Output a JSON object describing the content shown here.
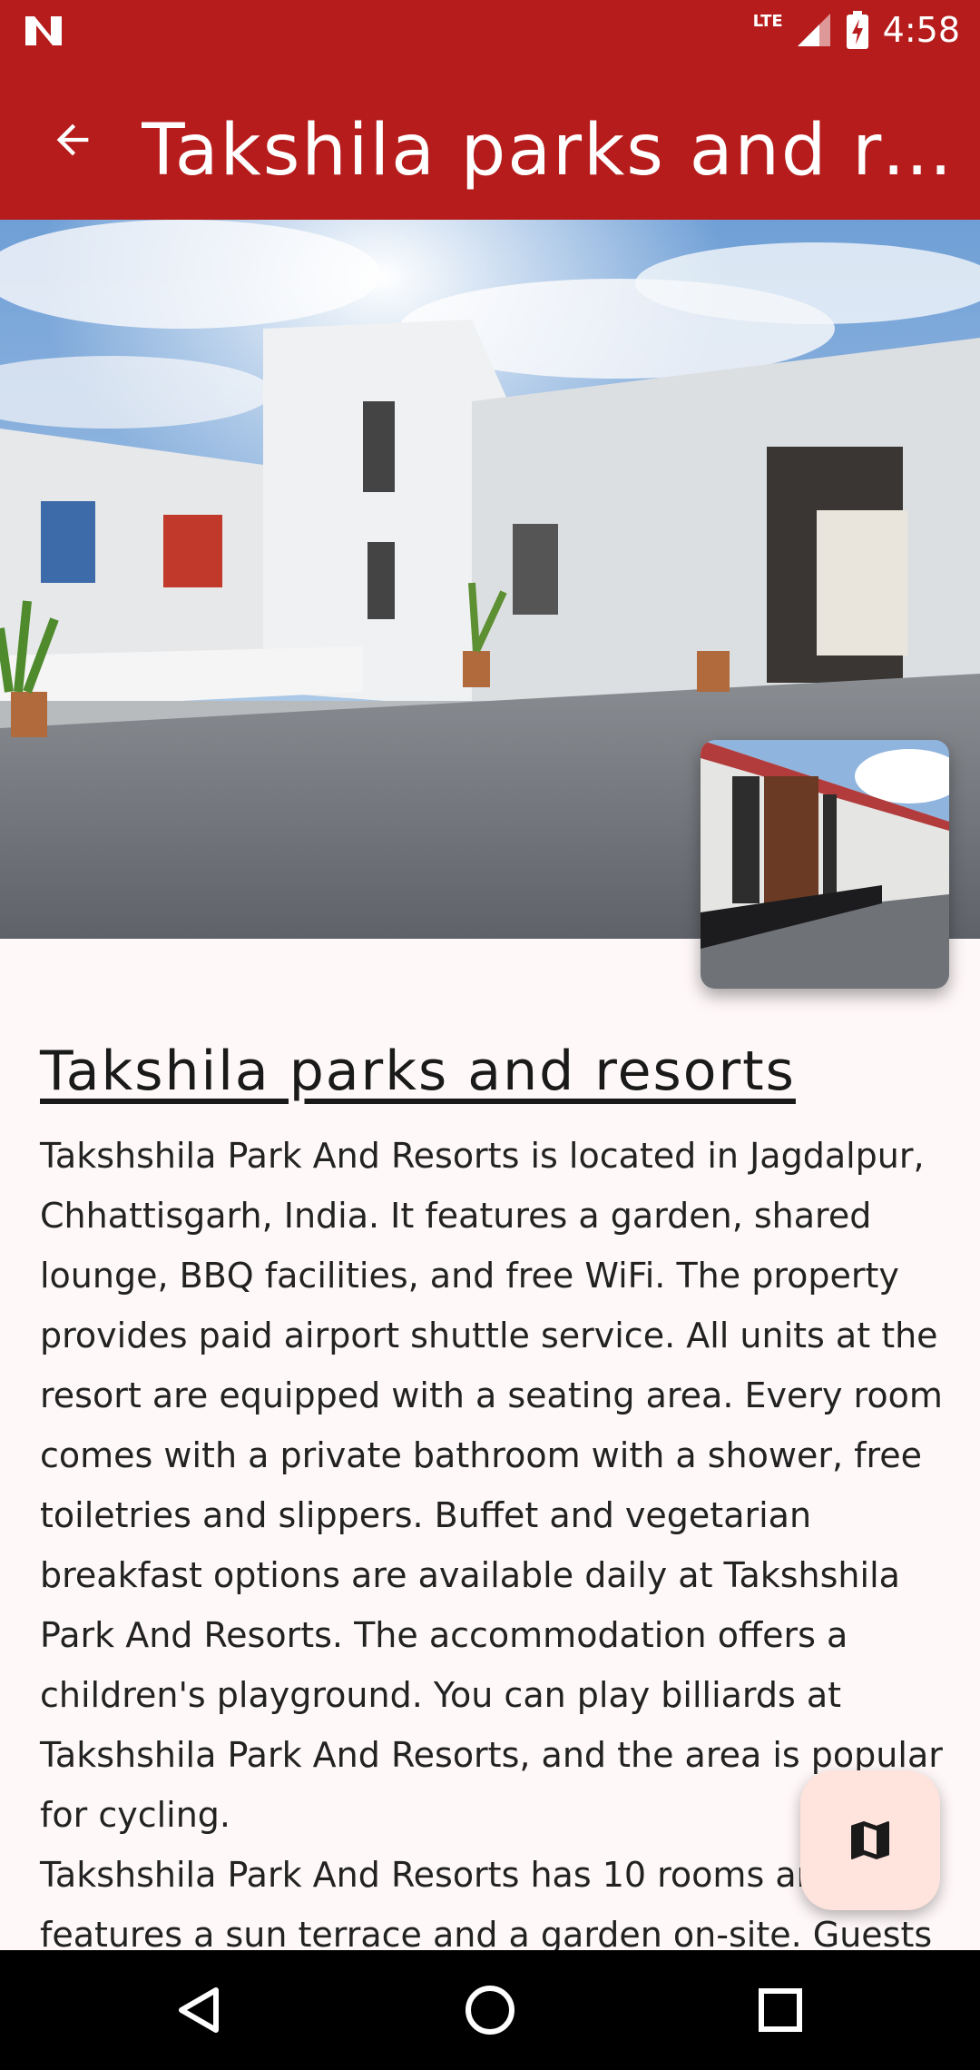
{
  "status_bar": {
    "time": "4:58",
    "network": "LTE",
    "left_icon": "n-logo-icon",
    "icons": [
      "signal-icon",
      "battery-charging-icon"
    ]
  },
  "app_bar": {
    "title": "Takshila parks and resorts",
    "back_icon": "arrow-back-icon"
  },
  "hero": {
    "main_image": "resort-courtyard-photo",
    "thumbnail_image": "resort-rooms-photo"
  },
  "content": {
    "heading": "Takshila parks and resorts",
    "paragraph_1": "Takshshila Park And Resorts is located in Jagdalpur, Chhattisgarh, India. It features a garden, shared lounge, BBQ facilities, and free WiFi. The property provides paid airport shuttle service. All units at the resort are equipped with a seating area. Every room comes with a private bathroom with a shower, free toiletries and slippers. Buffet and vegetarian breakfast options are available daily at Takshshila Park And Resorts. The accommodation offers a children's playground. You can play billiards at Takshshila Park And Resorts, and the area is popular for cycling.",
    "paragraph_2": "Takshshila Park And Resorts has 10 rooms and features a sun terrace and a garden on-site. Guests"
  },
  "fab": {
    "icon": "map-icon"
  },
  "nav_bar": {
    "icons": [
      "nav-back-icon",
      "nav-home-icon",
      "nav-recents-icon"
    ]
  },
  "colors": {
    "primary": "#b71c1c",
    "fab_bg": "#ffe3dd",
    "background": "#fff8f8"
  }
}
